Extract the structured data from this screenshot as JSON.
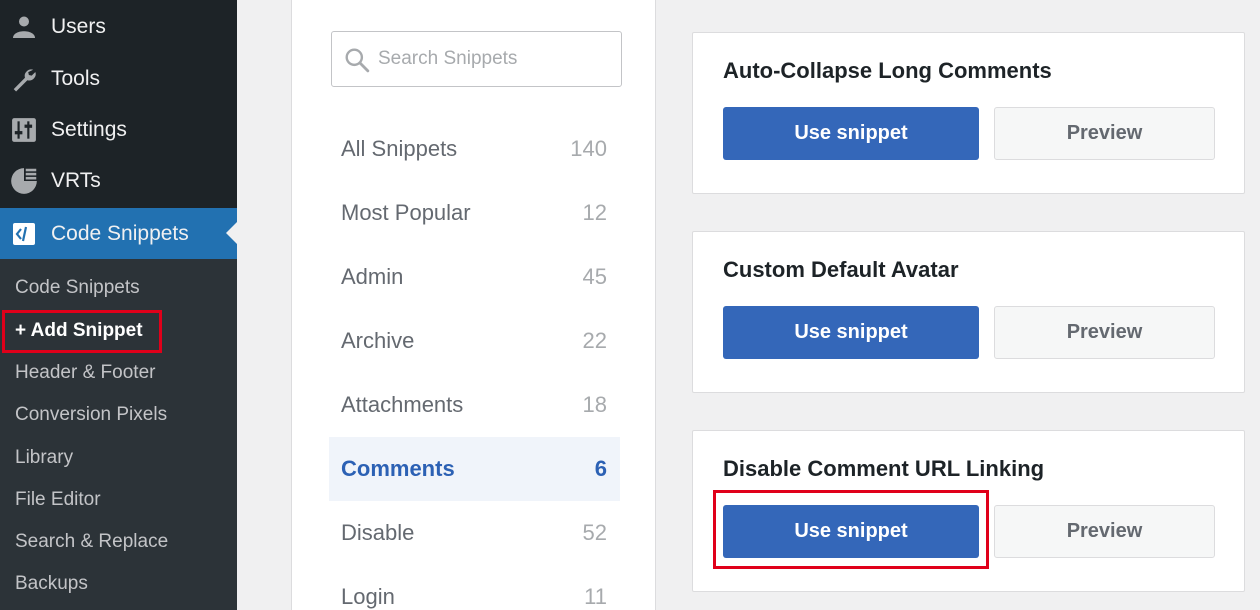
{
  "sidebar": {
    "menu": [
      {
        "label": "Users",
        "icon": "user-icon"
      },
      {
        "label": "Tools",
        "icon": "wrench-icon"
      },
      {
        "label": "Settings",
        "icon": "settings-sliders-icon"
      },
      {
        "label": "VRTs",
        "icon": "pie-chart-icon"
      },
      {
        "label": "Code Snippets",
        "icon": "code-snippets-icon"
      }
    ],
    "submenu": [
      {
        "label": "Code Snippets"
      },
      {
        "label": "+ Add Snippet"
      },
      {
        "label": "Header & Footer"
      },
      {
        "label": "Conversion Pixels"
      },
      {
        "label": "Library"
      },
      {
        "label": "File Editor"
      },
      {
        "label": "Search & Replace"
      },
      {
        "label": "Backups"
      }
    ]
  },
  "library": {
    "search_placeholder": "Search Snippets",
    "categories": [
      {
        "name": "All Snippets",
        "count": "140"
      },
      {
        "name": "Most Popular",
        "count": "12"
      },
      {
        "name": "Admin",
        "count": "45"
      },
      {
        "name": "Archive",
        "count": "22"
      },
      {
        "name": "Attachments",
        "count": "18"
      },
      {
        "name": "Comments",
        "count": "6"
      },
      {
        "name": "Disable",
        "count": "52"
      },
      {
        "name": "Login",
        "count": "11"
      }
    ]
  },
  "snippets": [
    {
      "title": "Auto-Collapse Long Comments",
      "use_label": "Use snippet",
      "preview_label": "Preview"
    },
    {
      "title": "Custom Default Avatar",
      "use_label": "Use snippet",
      "preview_label": "Preview"
    },
    {
      "title": "Disable Comment URL Linking",
      "use_label": "Use snippet",
      "preview_label": "Preview"
    }
  ],
  "colors": {
    "sidebar_bg": "#1d2327",
    "active_menu": "#2271b1",
    "primary_button": "#3467b9",
    "highlight": "#e0001a"
  }
}
